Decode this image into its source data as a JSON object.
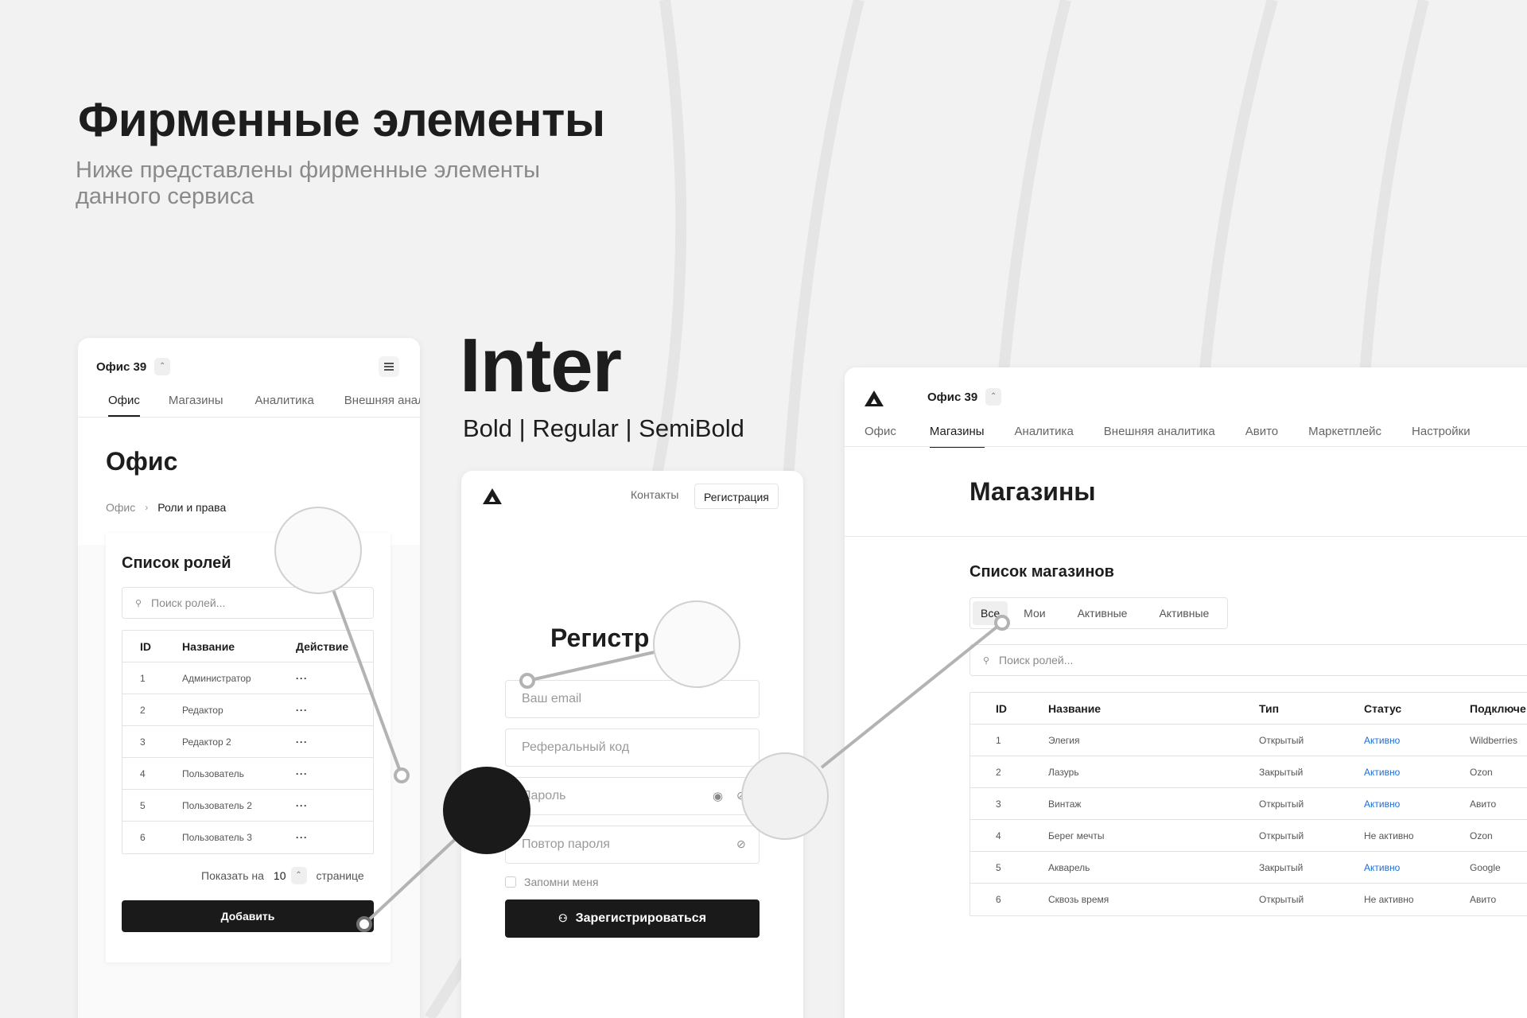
{
  "header": {
    "title": "Фирменные элементы",
    "subtitle_line1": "Ниже представлены фирменные элементы",
    "subtitle_line2": "данного сервиса"
  },
  "typography": {
    "font_name": "Inter",
    "weights": "Bold | Regular | SemiBold"
  },
  "colors": {
    "accent": "#1a1a1a",
    "link_active": "#1a6ed8",
    "background": "#f2f2f2"
  },
  "roles_card": {
    "office_name": "Офис 39",
    "menu_icon": "menu-icon",
    "tabs": [
      "Офис",
      "Магазины",
      "Аналитика",
      "Внешняя анал"
    ],
    "page_title": "Офис",
    "breadcrumb": [
      "Офис",
      "Роли и права"
    ],
    "list_title": "Список ролей",
    "search_placeholder": "Поиск ролей...",
    "columns": [
      "ID",
      "Название",
      "Действие"
    ],
    "rows": [
      {
        "id": "1",
        "name": "Администратор",
        "action": "···"
      },
      {
        "id": "2",
        "name": "Редактор",
        "action": "···"
      },
      {
        "id": "3",
        "name": "Редактор 2",
        "action": "···"
      },
      {
        "id": "4",
        "name": "Пользователь",
        "action": "···"
      },
      {
        "id": "5",
        "name": "Пользователь 2",
        "action": "···"
      },
      {
        "id": "6",
        "name": "Пользователь 3",
        "action": "···"
      }
    ],
    "pagination": {
      "label_before": "Показать на",
      "value": "10",
      "label_after": "странице"
    },
    "add_button": "Добавить"
  },
  "register_card": {
    "nav": {
      "contacts": "Контакты",
      "register": "Регистрация"
    },
    "title": "Регистр",
    "fields": {
      "email": "Ваш email",
      "referral": "Реферальный код",
      "password": "Пароль",
      "password_repeat": "Повтор пароля"
    },
    "remember_me": "Запомни меня",
    "submit": "Зарегистрироваться"
  },
  "stores_card": {
    "office_name": "Офис 39",
    "tabs": [
      "Офис",
      "Магазины",
      "Аналитика",
      "Внешняя аналитика",
      "Авито",
      "Маркетплейс",
      "Настройки"
    ],
    "page_title": "Магазины",
    "list_title": "Список магазинов",
    "filters": [
      "Все",
      "Мои",
      "Активные",
      "Активные"
    ],
    "search_placeholder": "Поиск ролей...",
    "columns": [
      "ID",
      "Название",
      "Тип",
      "Статус",
      "Подключе"
    ],
    "rows": [
      {
        "id": "1",
        "name": "Элегия",
        "type": "Открытый",
        "status": "Активно",
        "active": true,
        "conn": "Wildberries"
      },
      {
        "id": "2",
        "name": "Лазурь",
        "type": "Закрытый",
        "status": "Активно",
        "active": true,
        "conn": "Ozon"
      },
      {
        "id": "3",
        "name": "Винтаж",
        "type": "Открытый",
        "status": "Активно",
        "active": true,
        "conn": "Авито"
      },
      {
        "id": "4",
        "name": "Берег мечты",
        "type": "Открытый",
        "status": "Не активно",
        "active": false,
        "conn": "Ozon"
      },
      {
        "id": "5",
        "name": "Акварель",
        "type": "Закрытый",
        "status": "Активно",
        "active": true,
        "conn": "Google"
      },
      {
        "id": "6",
        "name": "Сквозь время",
        "type": "Открытый",
        "status": "Не активно",
        "active": false,
        "conn": "Авито"
      }
    ]
  }
}
